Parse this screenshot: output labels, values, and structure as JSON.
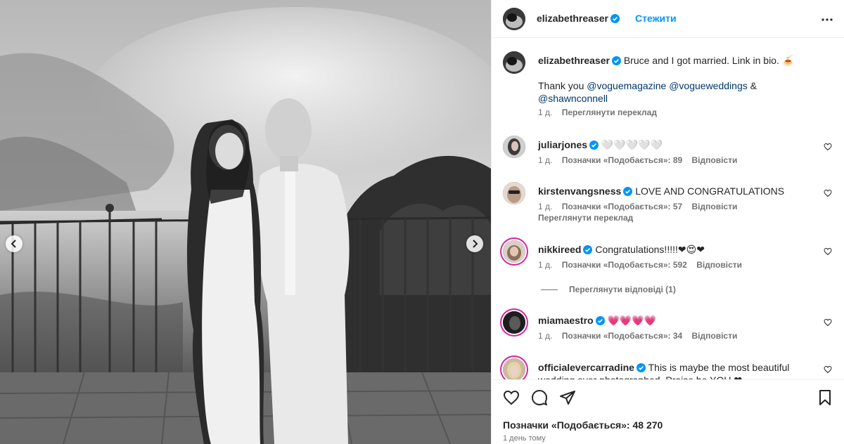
{
  "header": {
    "username": "elizabethreaser",
    "follow_label": "Стежити"
  },
  "caption": {
    "username": "elizabethreaser",
    "text": "Bruce and I got married. Link in bio. ",
    "emoji": "🍝",
    "thanks_text": "Thank you ",
    "mention1": "@voguemagazine",
    "mention2": "@vogueweddings",
    "amp": " & ",
    "mention3": "@shawnconnell",
    "age": "1 д.",
    "translate": "Переглянути переклад"
  },
  "comments": [
    {
      "username": "juliarjones",
      "text": "🤍🤍🤍🤍🤍",
      "age": "1 д.",
      "likes": "Позначки «Подобається»: 89",
      "reply": "Відповісти"
    },
    {
      "username": "kirstenvangsness",
      "text": "LOVE AND CONGRATULATIONS",
      "age": "1 д.",
      "likes": "Позначки «Подобається»: 57",
      "reply": "Відповісти",
      "translate": "Переглянути переклад"
    },
    {
      "username": "nikkireed",
      "text": "Congratulations!!!!!❤😍❤",
      "age": "1 д.",
      "likes": "Позначки «Подобається»: 592",
      "reply": "Відповісти",
      "view_replies": "Переглянути відповіді (1)"
    },
    {
      "username": "miamaestro",
      "text": "💗💗💗💗",
      "age": "1 д.",
      "likes": "Позначки «Подобається»: 34",
      "reply": "Відповісти"
    },
    {
      "username": "officialevercarradine",
      "text": "This is maybe the most beautiful wedding ever photographed. Praise be YOU ❤"
    }
  ],
  "footer": {
    "likes": "Позначки «Подобається»: 48 270",
    "time": "1 день тому"
  },
  "icons": {
    "verified_color": "#0095f6",
    "follow_color": "#0095f6"
  }
}
